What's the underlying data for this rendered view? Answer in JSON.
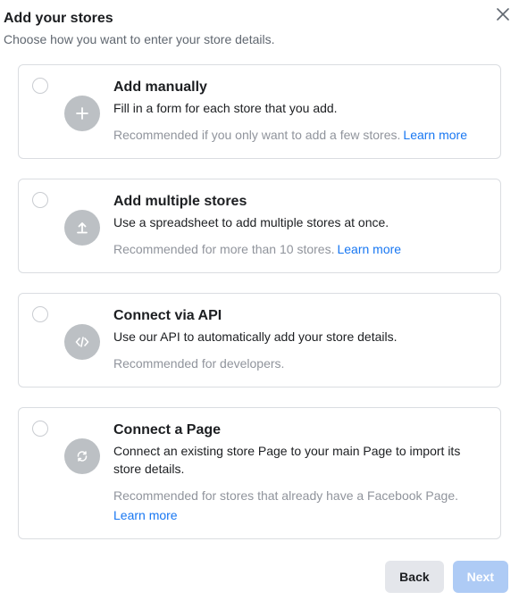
{
  "header": {
    "title": "Add your stores",
    "subtitle": "Choose how you want to enter your store details."
  },
  "options": [
    {
      "icon": "plus-icon",
      "title": "Add manually",
      "desc": "Fill in a form for each store that you add.",
      "hint": "Recommended if you only want to add a few stores.",
      "learn": "Learn more",
      "learn_inline": true
    },
    {
      "icon": "upload-icon",
      "title": "Add multiple stores",
      "desc": "Use a spreadsheet to add multiple stores at once.",
      "hint": "Recommended for more than 10 stores.",
      "learn": "Learn more",
      "learn_inline": true
    },
    {
      "icon": "code-icon",
      "title": "Connect via API",
      "desc": "Use our API to automatically add your store details.",
      "hint": "Recommended for developers.",
      "learn": "",
      "learn_inline": true
    },
    {
      "icon": "sync-icon",
      "title": "Connect a Page",
      "desc": "Connect an existing store Page to your main Page to import its store details.",
      "hint": "Recommended for stores that already have a Facebook Page.",
      "learn": "Learn more",
      "learn_inline": false
    }
  ],
  "footer": {
    "back": "Back",
    "next": "Next"
  }
}
